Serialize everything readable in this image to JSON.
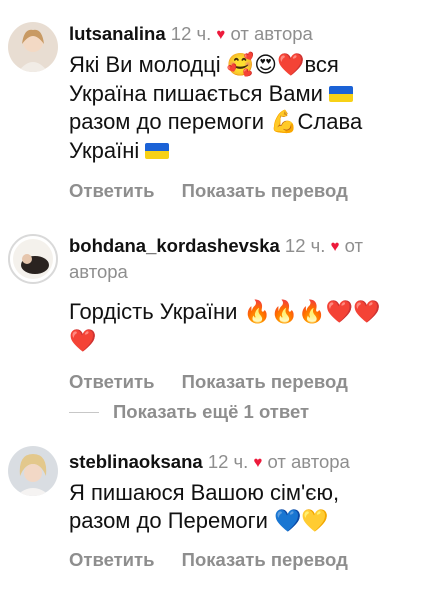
{
  "comments": [
    {
      "username": "lutsanalina",
      "time": "12 ч.",
      "by_author": "от автора",
      "lines": [
        {
          "text": "Які Ви молодці ",
          "emoji": "🥰😍❤️",
          "after": "вся"
        },
        {
          "text": "Україна пишається Вами ",
          "flag": true
        },
        {
          "text": "разом до перемоги ",
          "emoji": "💪",
          "after": "Слава"
        },
        {
          "text": "Україні ",
          "flag": true
        }
      ],
      "reply_label": "Ответить",
      "translate_label": "Показать перевод"
    },
    {
      "username": "bohdana_kordashevska",
      "time": "12 ч.",
      "by_author_1": "от",
      "by_author_2": "автора",
      "lines": [
        {
          "text": "Гордість України ",
          "emoji": "🔥🔥🔥❤️❤️"
        },
        {
          "emoji": "❤️"
        }
      ],
      "reply_label": "Ответить",
      "translate_label": "Показать перевод",
      "show_more_replies": "Показать ещё 1 ответ"
    },
    {
      "username": "steblinaoksana",
      "time": "12 ч.",
      "by_author": "от автора",
      "lines": [
        {
          "text": "Я пишаюся Вашою сім'єю,"
        },
        {
          "text": "разом до Перемоги ",
          "emoji": "💙💛"
        }
      ],
      "reply_label": "Ответить",
      "translate_label": "Показать перевод"
    }
  ],
  "colors": {
    "text": "#111111",
    "muted": "#8e8e8e",
    "heart": "#ed1a3b",
    "flag_blue": "#1b62d6",
    "flag_yellow": "#f7d116"
  },
  "icons": {
    "heart": "♥"
  }
}
